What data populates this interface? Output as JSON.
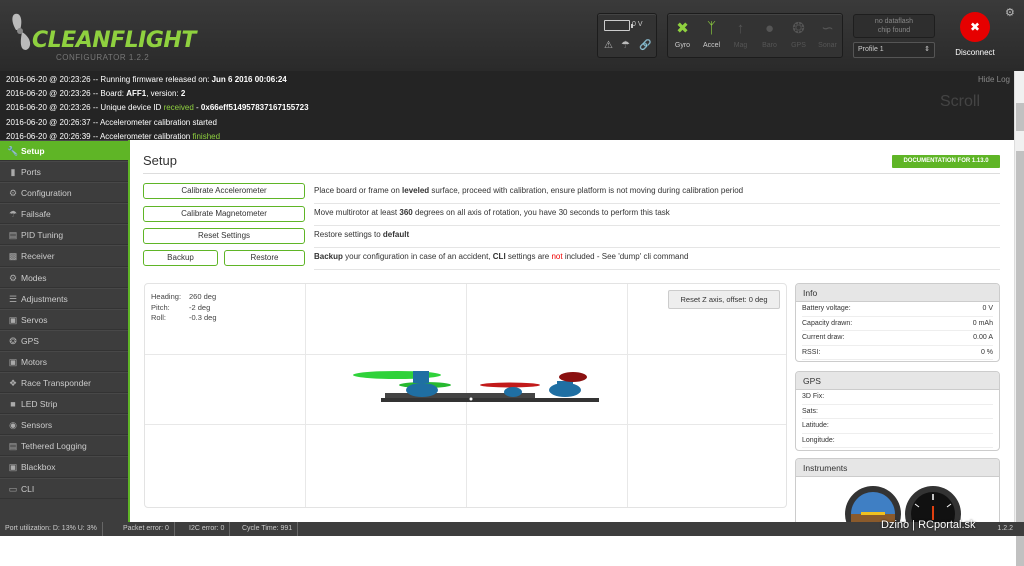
{
  "header": {
    "app_name": "CLEANFLIGHT",
    "app_subtitle": "CONFIGURATOR   1.2.2",
    "battery_voltage": "0 V",
    "status_icons": [
      "warning-icon",
      "failsafe-icon",
      "link-icon"
    ],
    "sensors": [
      {
        "label": "Gyro",
        "icon": "gyro-icon",
        "active": true
      },
      {
        "label": "Accel",
        "icon": "accel-icon",
        "active": true
      },
      {
        "label": "Mag",
        "icon": "mag-icon",
        "active": false
      },
      {
        "label": "Baro",
        "icon": "baro-icon",
        "active": false
      },
      {
        "label": "GPS",
        "icon": "gps-icon",
        "active": false
      },
      {
        "label": "Sonar",
        "icon": "sonar-icon",
        "active": false
      }
    ],
    "dataflash_line1": "no dataflash",
    "dataflash_line2": "chip found",
    "profile": "Profile 1",
    "disconnect_label": "Disconnect",
    "accent_color": "#5fb526",
    "disconnect_color": "#e60000"
  },
  "log": {
    "hide_label": "Hide Log",
    "scroll_label": "Scroll",
    "lines": [
      {
        "ts": "2016-06-20 @ 20:23:26",
        "text": " -- Running firmware released on: ",
        "bold": "Jun 6 2016 00:06:24",
        "green": "",
        "after": ""
      },
      {
        "ts": "2016-06-20 @ 20:23:26",
        "text": " -- Board: ",
        "bold": "AFF1",
        "green": "",
        "after": ", version: ",
        "bold2": "2"
      },
      {
        "ts": "2016-06-20 @ 20:23:26",
        "text": " -- Unique device ID ",
        "bold": "",
        "green": "received",
        "after": " - ",
        "bold2": "0x66eff514957837167155723"
      },
      {
        "ts": "2016-06-20 @ 20:26:37",
        "text": " -- Accelerometer calibration started",
        "bold": "",
        "green": "",
        "after": ""
      },
      {
        "ts": "2016-06-20 @ 20:26:39",
        "text": " -- Accelerometer calibration ",
        "bold": "",
        "green": "finished",
        "after": ""
      }
    ]
  },
  "sidebar": {
    "items": [
      {
        "label": "Setup",
        "icon": "wrench-icon",
        "active": true
      },
      {
        "label": "Ports",
        "icon": "ports-icon"
      },
      {
        "label": "Configuration",
        "icon": "gear-icon"
      },
      {
        "label": "Failsafe",
        "icon": "failsafe-icon"
      },
      {
        "label": "PID Tuning",
        "icon": "pid-icon"
      },
      {
        "label": "Receiver",
        "icon": "receiver-icon"
      },
      {
        "label": "Modes",
        "icon": "modes-icon"
      },
      {
        "label": "Adjustments",
        "icon": "adjustments-icon"
      },
      {
        "label": "Servos",
        "icon": "servos-icon"
      },
      {
        "label": "GPS",
        "icon": "gps-icon"
      },
      {
        "label": "Motors",
        "icon": "motors-icon"
      },
      {
        "label": "Race Transponder",
        "icon": "transponder-icon"
      },
      {
        "label": "LED Strip",
        "icon": "led-icon"
      },
      {
        "label": "Sensors",
        "icon": "sensors-icon"
      },
      {
        "label": "Tethered Logging",
        "icon": "logging-icon"
      },
      {
        "label": "Blackbox",
        "icon": "blackbox-icon"
      },
      {
        "label": "CLI",
        "icon": "cli-icon"
      }
    ]
  },
  "setup": {
    "title": "Setup",
    "documentation": "DOCUMENTATION FOR 1.13.0",
    "calibrate_acc": "Calibrate Accelerometer",
    "calibrate_acc_desc_1": "Place board or frame on ",
    "calibrate_acc_desc_b": "leveled",
    "calibrate_acc_desc_2": " surface, proceed with calibration, ensure platform is not moving during calibration period",
    "calibrate_mag": "Calibrate Magnetometer",
    "calibrate_mag_desc_1": "Move multirotor at least ",
    "calibrate_mag_desc_b": "360",
    "calibrate_mag_desc_2": " degrees on all axis of rotation, you have 30 seconds to perform this task",
    "reset": "Reset Settings",
    "reset_desc_1": "Restore settings to ",
    "reset_desc_b": "default",
    "backup": "Backup",
    "restore": "Restore",
    "backup_desc_b1": "Backup",
    "backup_desc_1": " your configuration in case of an accident, ",
    "backup_desc_b2": "CLI",
    "backup_desc_2": " settings are ",
    "backup_desc_red": "not",
    "backup_desc_3": " included - See 'dump' cli command",
    "heading_label": "Heading:",
    "heading": "260 deg",
    "pitch_label": "Pitch:",
    "pitch": "-2 deg",
    "roll_label": "Roll:",
    "roll": "-0.3 deg",
    "reset_z": "Reset Z axis, offset: 0 deg"
  },
  "info": {
    "title": "Info",
    "rows": [
      {
        "label": "Battery voltage:",
        "value": "0 V"
      },
      {
        "label": "Capacity drawn:",
        "value": "0 mAh"
      },
      {
        "label": "Current draw:",
        "value": "0.00 A"
      },
      {
        "label": "RSSI:",
        "value": "0 %"
      }
    ]
  },
  "gps": {
    "title": "GPS",
    "rows": [
      {
        "label": "3D Fix:",
        "value": ""
      },
      {
        "label": "Sats:",
        "value": ""
      },
      {
        "label": "Latitude:",
        "value": ""
      },
      {
        "label": "Longitude:",
        "value": ""
      }
    ]
  },
  "instruments": {
    "title": "Instruments"
  },
  "status": {
    "port": "Port utilization: D: 13% U: 3%",
    "packet": "Packet error: 0",
    "i2c": "I2C error: 0",
    "cycle": "Cycle Time: 991",
    "version": "1.2.2",
    "watermark": "Dzino | RCportal.sk"
  }
}
